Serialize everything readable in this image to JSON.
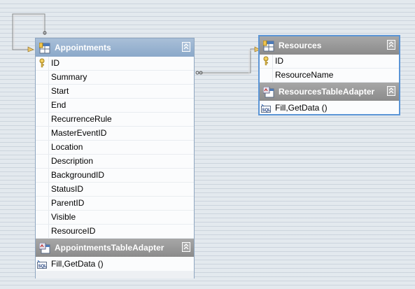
{
  "appointments": {
    "title": "Appointments",
    "columns": [
      "ID",
      "Summary",
      "Start",
      "End",
      "RecurrenceRule",
      "MasterEventID",
      "Location",
      "Description",
      "BackgroundID",
      "StatusID",
      "ParentID",
      "Visible",
      "ResourceID"
    ],
    "adapter_title": "AppointmentsTableAdapter",
    "adapter_method": "Fill,GetData ()"
  },
  "resources": {
    "title": "Resources",
    "columns": [
      "ID",
      "ResourceName"
    ],
    "adapter_title": "ResourcesTableAdapter",
    "adapter_method": "Fill,GetData ()"
  },
  "icons": {
    "table": "table-icon",
    "adapter": "table-adapter-icon",
    "key": "primary-key-icon",
    "query": "sql-query-icon",
    "collapse": "collapse-chevron-icon"
  },
  "colors": {
    "canvas": "#e3e9ee",
    "title_blue": "#8aa8c9",
    "title_gray": "#8b8b8b",
    "selected_border": "#5b95d6"
  }
}
